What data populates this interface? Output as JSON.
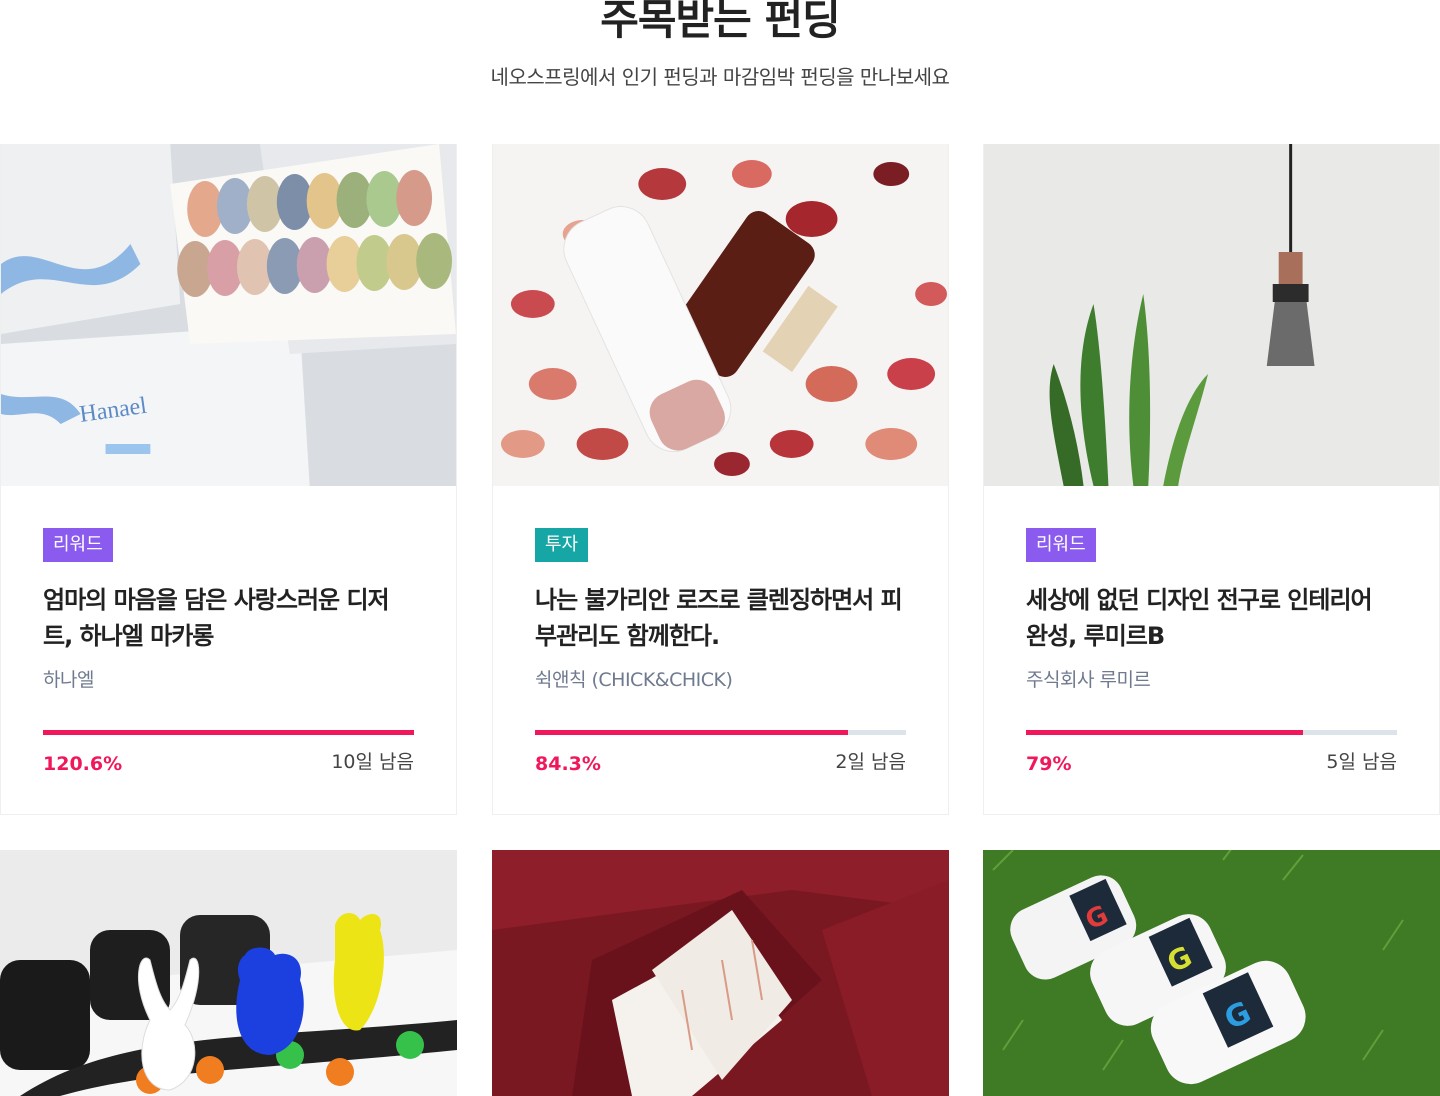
{
  "section": {
    "title": "주목받는 펀딩",
    "subtitle": "네오스프링에서 인기 펀딩과 마감임박 펀딩을 만나보세요"
  },
  "colors": {
    "accent": "#f0185b",
    "reward_badge": "#8b5bef",
    "invest_badge": "#17a6a6",
    "track": "#dde3eb"
  },
  "cards": [
    {
      "image": "macaron-box-photo",
      "badge": "리워드",
      "badge_type": "reward",
      "title": "엄마의 마음을 담은 사랑스러운 디저트, 하나엘 마카롱",
      "maker": "하나엘",
      "progress": 1.0,
      "percent": "120.6%",
      "remaining": "10일 남음"
    },
    {
      "image": "rose-cleanser-photo",
      "badge": "투자",
      "badge_type": "invest",
      "title": "나는 불가리안 로즈로 클렌징하면서 피부관리도 함께한다.",
      "maker": "쉭앤칙 (CHICK&CHICK)",
      "progress": 0.843,
      "percent": "84.3%",
      "remaining": "2일 남음"
    },
    {
      "image": "pendant-lamp-photo",
      "badge": "리워드",
      "badge_type": "reward",
      "title": "세상에 없던 디자인 전구로 인테리어 완성, 루미르B",
      "maker": "주식회사 루미르",
      "progress": 0.746,
      "percent": "79%",
      "remaining": "5일 남음"
    }
  ],
  "bottom_cards": [
    {
      "image": "character-boardgame-photo"
    },
    {
      "image": "red-gift-box-photo"
    },
    {
      "image": "bottles-on-grass-photo"
    }
  ]
}
